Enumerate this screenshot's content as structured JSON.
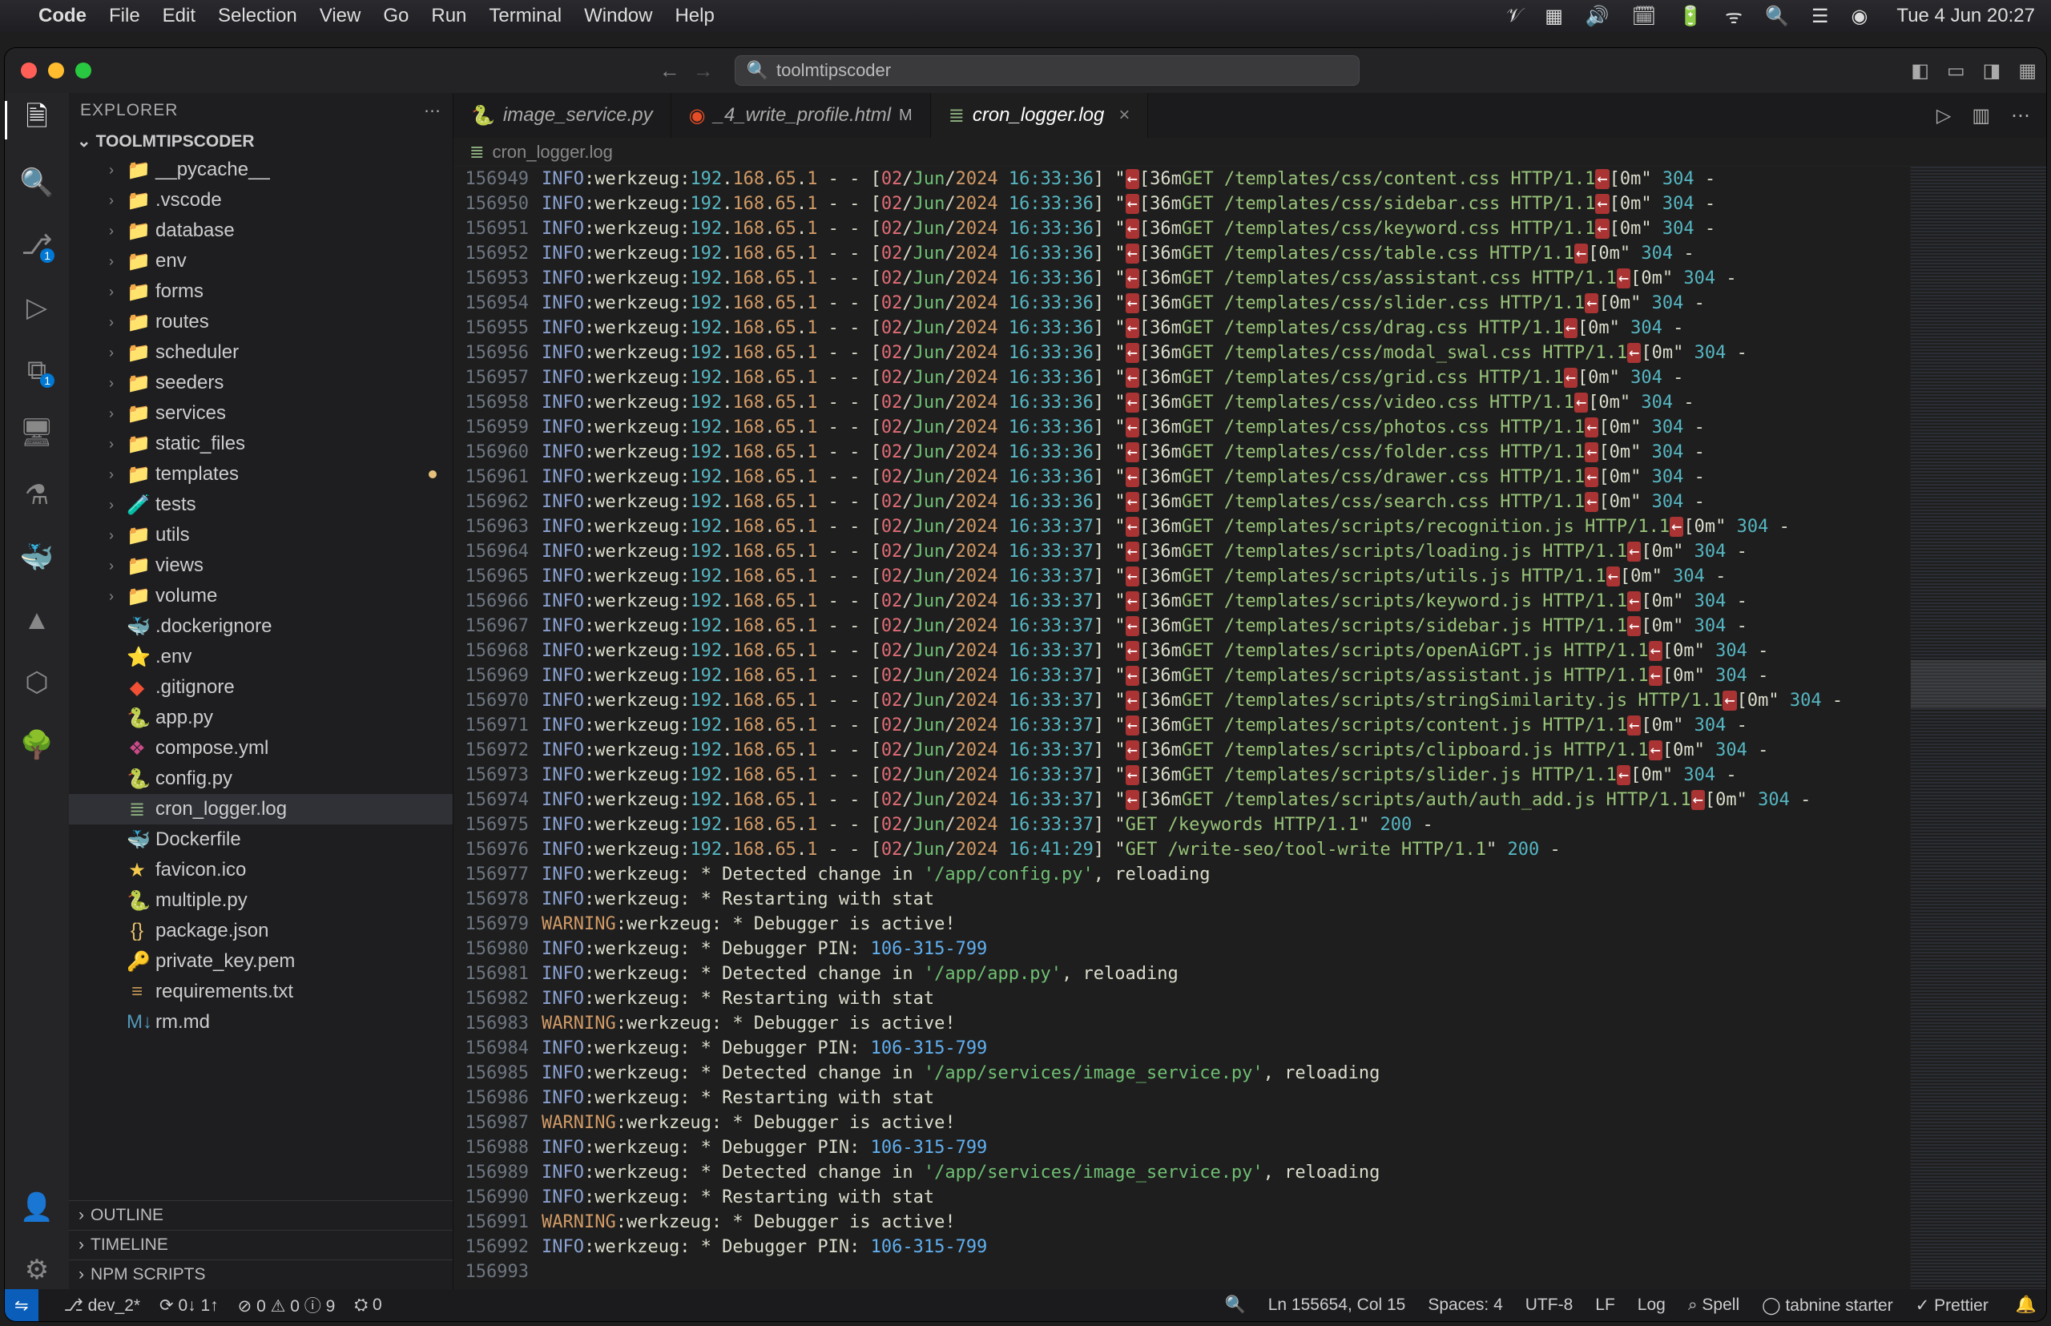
{
  "macos": {
    "app_name": "Code",
    "menus": [
      "File",
      "Edit",
      "Selection",
      "View",
      "Go",
      "Run",
      "Terminal",
      "Window",
      "Help"
    ],
    "clock": "Tue 4 Jun  20:27"
  },
  "titlebar": {
    "search_text": "toolmtipscoder"
  },
  "sidebar": {
    "title": "EXPLORER",
    "project": "TOOLMTIPSCODER",
    "entries": [
      {
        "kind": "folder",
        "name": "__pycache__",
        "icon": "📁"
      },
      {
        "kind": "folder",
        "name": ".vscode",
        "icon": "📁"
      },
      {
        "kind": "folder",
        "name": "database",
        "icon": "📁"
      },
      {
        "kind": "folder",
        "name": "env",
        "icon": "📁"
      },
      {
        "kind": "folder",
        "name": "forms",
        "icon": "📁"
      },
      {
        "kind": "folder",
        "name": "routes",
        "icon": "📁"
      },
      {
        "kind": "folder",
        "name": "scheduler",
        "icon": "📁"
      },
      {
        "kind": "folder",
        "name": "seeders",
        "icon": "📁"
      },
      {
        "kind": "folder",
        "name": "services",
        "icon": "📁"
      },
      {
        "kind": "folder",
        "name": "static_files",
        "icon": "📁"
      },
      {
        "kind": "folder",
        "name": "templates",
        "icon": "📁",
        "modified": true
      },
      {
        "kind": "folder",
        "name": "tests",
        "icon": "🧪"
      },
      {
        "kind": "folder",
        "name": "utils",
        "icon": "📁"
      },
      {
        "kind": "folder",
        "name": "views",
        "icon": "📁"
      },
      {
        "kind": "folder",
        "name": "volume",
        "icon": "📁"
      },
      {
        "kind": "file",
        "name": ".dockerignore",
        "icon": "🐳",
        "cls": "icon-docker"
      },
      {
        "kind": "file",
        "name": ".env",
        "icon": "⭐",
        "cls": "icon-star"
      },
      {
        "kind": "file",
        "name": ".gitignore",
        "icon": "◆",
        "cls": "icon-git"
      },
      {
        "kind": "file",
        "name": "app.py",
        "icon": "🐍",
        "cls": "icon-py"
      },
      {
        "kind": "file",
        "name": "compose.yml",
        "icon": "❖",
        "cls": "icon-yml"
      },
      {
        "kind": "file",
        "name": "config.py",
        "icon": "🐍",
        "cls": "icon-py"
      },
      {
        "kind": "file",
        "name": "cron_logger.log",
        "icon": "≣",
        "cls": "icon-log",
        "selected": true
      },
      {
        "kind": "file",
        "name": "Dockerfile",
        "icon": "🐳",
        "cls": "icon-docker"
      },
      {
        "kind": "file",
        "name": "favicon.ico",
        "icon": "★",
        "cls": "icon-star"
      },
      {
        "kind": "file",
        "name": "multiple.py",
        "icon": "🐍",
        "cls": "icon-py"
      },
      {
        "kind": "file",
        "name": "package.json",
        "icon": "{}",
        "cls": "icon-json"
      },
      {
        "kind": "file",
        "name": "private_key.pem",
        "icon": "🔑",
        "cls": "icon-key"
      },
      {
        "kind": "file",
        "name": "requirements.txt",
        "icon": "≡",
        "cls": ""
      },
      {
        "kind": "file",
        "name": "rm.md",
        "icon": "M↓",
        "cls": "icon-md"
      }
    ],
    "collapse_sections": [
      "OUTLINE",
      "TIMELINE",
      "NPM SCRIPTS"
    ]
  },
  "tabs": [
    {
      "label": "image_service.py",
      "icon": "🐍",
      "cls": "icon-py"
    },
    {
      "label": "_4_write_profile.html",
      "icon": "◉",
      "cls": "icon-html",
      "modified": "M"
    },
    {
      "label": "cron_logger.log",
      "icon": "≣",
      "cls": "icon-log",
      "active": true,
      "close": true
    }
  ],
  "breadcrumb": {
    "file": "cron_logger.log"
  },
  "log": {
    "first_line": 156949,
    "ip": "192.168.65.1",
    "date_day": "02",
    "date_mon": "Jun",
    "date_year": "2024",
    "times": {
      "a": "16:33:36",
      "b": "16:33:37",
      "c": "16:41:29"
    },
    "http_lines": [
      {
        "t": "a",
        "path": "/templates/css/content.css",
        "status": "304"
      },
      {
        "t": "a",
        "path": "/templates/css/sidebar.css",
        "status": "304"
      },
      {
        "t": "a",
        "path": "/templates/css/keyword.css",
        "status": "304"
      },
      {
        "t": "a",
        "path": "/templates/css/table.css",
        "status": "304"
      },
      {
        "t": "a",
        "path": "/templates/css/assistant.css",
        "status": "304"
      },
      {
        "t": "a",
        "path": "/templates/css/slider.css",
        "status": "304"
      },
      {
        "t": "a",
        "path": "/templates/css/drag.css",
        "status": "304"
      },
      {
        "t": "a",
        "path": "/templates/css/modal_swal.css",
        "status": "304"
      },
      {
        "t": "a",
        "path": "/templates/css/grid.css",
        "status": "304"
      },
      {
        "t": "a",
        "path": "/templates/css/video.css",
        "status": "304"
      },
      {
        "t": "a",
        "path": "/templates/css/photos.css",
        "status": "304"
      },
      {
        "t": "a",
        "path": "/templates/css/folder.css",
        "status": "304"
      },
      {
        "t": "a",
        "path": "/templates/css/drawer.css",
        "status": "304"
      },
      {
        "t": "a",
        "path": "/templates/css/search.css",
        "status": "304"
      },
      {
        "t": "b",
        "path": "/templates/scripts/recognition.js",
        "status": "304"
      },
      {
        "t": "b",
        "path": "/templates/scripts/loading.js",
        "status": "304"
      },
      {
        "t": "b",
        "path": "/templates/scripts/utils.js",
        "status": "304"
      },
      {
        "t": "b",
        "path": "/templates/scripts/keyword.js",
        "status": "304"
      },
      {
        "t": "b",
        "path": "/templates/scripts/sidebar.js",
        "status": "304"
      },
      {
        "t": "b",
        "path": "/templates/scripts/openAiGPT.js",
        "status": "304"
      },
      {
        "t": "b",
        "path": "/templates/scripts/assistant.js",
        "status": "304"
      },
      {
        "t": "b",
        "path": "/templates/scripts/stringSimilarity.js",
        "status": "304"
      },
      {
        "t": "b",
        "path": "/templates/scripts/content.js",
        "status": "304"
      },
      {
        "t": "b",
        "path": "/templates/scripts/clipboard.js",
        "status": "304"
      },
      {
        "t": "b",
        "path": "/templates/scripts/slider.js",
        "status": "304"
      },
      {
        "t": "b",
        "path": "/templates/scripts/auth/auth_add.js",
        "status": "304"
      }
    ],
    "plain_get_lines": [
      {
        "t": "b",
        "req": "GET /keywords HTTP/1.1",
        "status": "200"
      },
      {
        "t": "c",
        "req": "GET /write-seo/tool-write HTTP/1.1",
        "status": "200"
      }
    ],
    "tail": [
      {
        "type": "info",
        "text": " * Detected change in ",
        "path": "'/app/config.py'",
        "suffix": ", reloading"
      },
      {
        "type": "info",
        "text": " * Restarting with stat"
      },
      {
        "type": "warn",
        "text": " * Debugger is active!"
      },
      {
        "type": "info",
        "text": " * Debugger PIN: ",
        "pin": "106-315-799"
      },
      {
        "type": "info",
        "text": " * Detected change in ",
        "path": "'/app/app.py'",
        "suffix": ", reloading"
      },
      {
        "type": "info",
        "text": " * Restarting with stat"
      },
      {
        "type": "warn",
        "text": " * Debugger is active!"
      },
      {
        "type": "info",
        "text": " * Debugger PIN: ",
        "pin": "106-315-799"
      },
      {
        "type": "info",
        "text": " * Detected change in ",
        "path": "'/app/services/image_service.py'",
        "suffix": ", reloading"
      },
      {
        "type": "info",
        "text": " * Restarting with stat"
      },
      {
        "type": "warn",
        "text": " * Debugger is active!"
      },
      {
        "type": "info",
        "text": " * Debugger PIN: ",
        "pin": "106-315-799"
      },
      {
        "type": "info",
        "text": " * Detected change in ",
        "path": "'/app/services/image_service.py'",
        "suffix": ", reloading"
      },
      {
        "type": "info",
        "text": " * Restarting with stat"
      },
      {
        "type": "warn",
        "text": " * Debugger is active!"
      },
      {
        "type": "info",
        "text": " * Debugger PIN: ",
        "pin": "106-315-799"
      },
      {
        "type": "blank"
      }
    ]
  },
  "statusbar": {
    "remote": "⇋",
    "branch": "dev_2*",
    "sync": "⟳ 0↓ 1↑",
    "errors": "⊘ 0 ⚠ 0 ⓘ 9",
    "port": "⛭ 0",
    "cursor": "Ln 155654, Col 15",
    "spaces": "Spaces: 4",
    "encoding": "UTF-8",
    "eol": "LF",
    "lang": "Log",
    "spell": "⌕ Spell",
    "tabnine": "◯ tabnine starter",
    "prettier": "✓ Prettier"
  }
}
